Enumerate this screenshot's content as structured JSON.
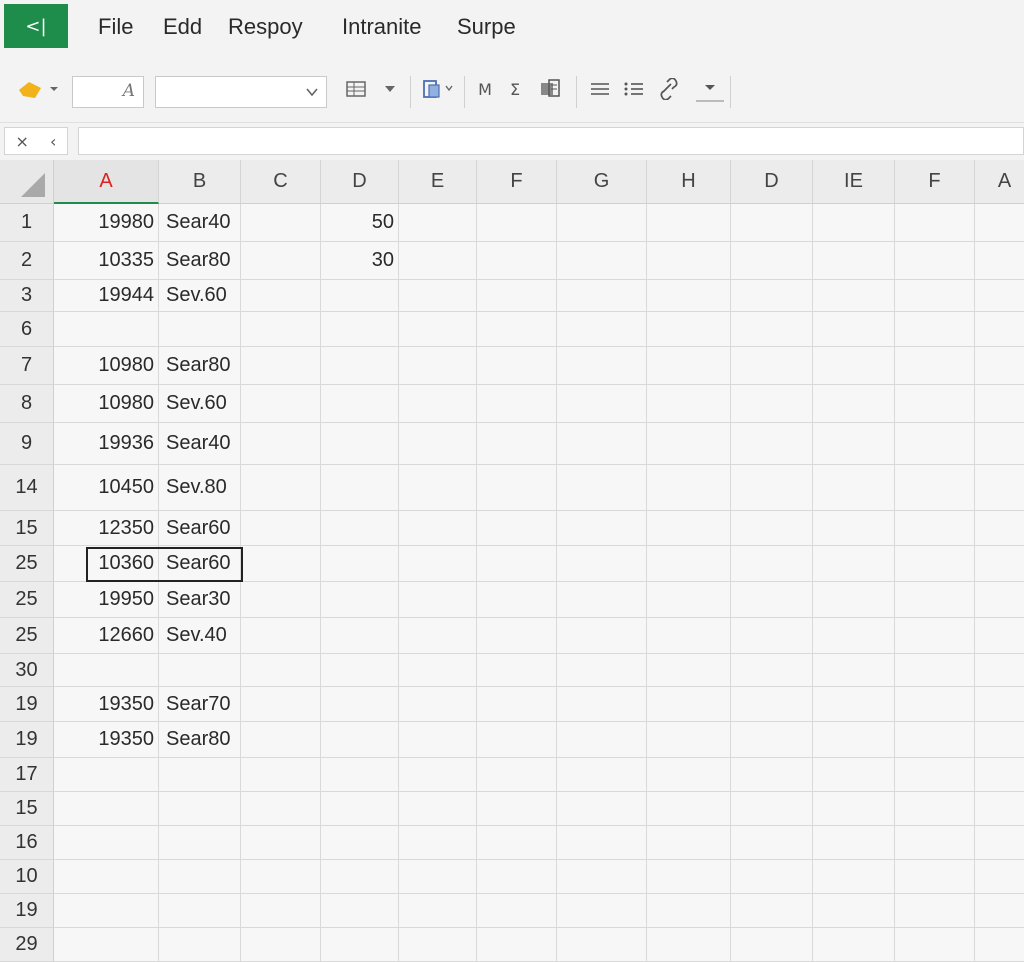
{
  "app_button": "<|",
  "menu": [
    "File",
    "Edd",
    "Respoy",
    "Intranite",
    "Surpe"
  ],
  "toolbar": {
    "font_size_placeholder": "A",
    "font_name_value": "",
    "btn_m": "M",
    "btn_sigma": "Σ"
  },
  "formula_bar": {
    "cancel": "×",
    "enter": "‹",
    "value": ""
  },
  "columns": [
    "A",
    "B",
    "C",
    "D",
    "E",
    "F",
    "G",
    "H",
    "D",
    "IE",
    "F",
    "A"
  ],
  "active_column_index": 0,
  "rows": [
    {
      "label": "1",
      "a": "19980",
      "b": "Sear40",
      "d": "50"
    },
    {
      "label": "2",
      "a": "10335",
      "b": "Sear80",
      "d": "30"
    },
    {
      "label": "3",
      "a": "19944",
      "b": "Sev.60",
      "d": ""
    },
    {
      "label": "6",
      "a": "",
      "b": "",
      "d": ""
    },
    {
      "label": "7",
      "a": "10980",
      "b": "Sear80",
      "d": ""
    },
    {
      "label": "8",
      "a": "10980",
      "b": "Sev.60",
      "d": ""
    },
    {
      "label": "9",
      "a": "19936",
      "b": "Sear40",
      "d": ""
    },
    {
      "label": "14",
      "a": "10450",
      "b": "Sev.80",
      "d": ""
    },
    {
      "label": "15",
      "a": "12350",
      "b": "Sear60",
      "d": ""
    },
    {
      "label": "25",
      "a": "10360",
      "b": "Sear60",
      "d": ""
    },
    {
      "label": "25",
      "a": "19950",
      "b": "Sear30",
      "d": ""
    },
    {
      "label": "25",
      "a": "12660",
      "b": "Sev.40",
      "d": ""
    },
    {
      "label": "30",
      "a": "",
      "b": "",
      "d": ""
    },
    {
      "label": "19",
      "a": "19350",
      "b": "Sear70",
      "d": ""
    },
    {
      "label": "19",
      "a": "19350",
      "b": "Sear80",
      "d": ""
    },
    {
      "label": "17",
      "a": "",
      "b": "",
      "d": ""
    },
    {
      "label": "15",
      "a": "",
      "b": "",
      "d": ""
    },
    {
      "label": "16",
      "a": "",
      "b": "",
      "d": ""
    },
    {
      "label": "10",
      "a": "",
      "b": "",
      "d": ""
    },
    {
      "label": "19",
      "a": "",
      "b": "",
      "d": ""
    },
    {
      "label": "29",
      "a": "",
      "b": "",
      "d": ""
    }
  ],
  "selected_row_index": 9,
  "colors": {
    "accent": "#1e8c4a",
    "active_header_text": "#d22222"
  }
}
